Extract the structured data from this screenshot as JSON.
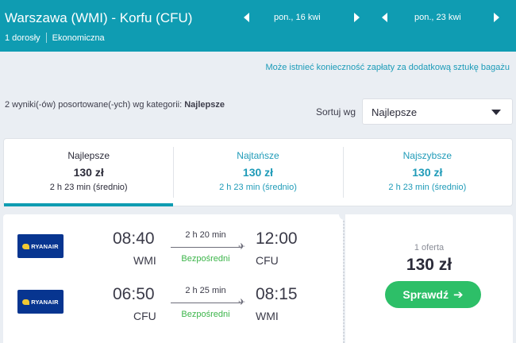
{
  "header": {
    "route": "Warszawa (WMI) - Korfu (CFU)",
    "passengers": "1 dorosły",
    "cabin": "Ekonomiczna",
    "departure_date": "pon., 16 kwi",
    "return_date": "pon., 23 kwi"
  },
  "bag_notice": "Może istnieć konieczność zapłaty za dodatkową sztukę bagażu",
  "results": {
    "count_text": "2 wyniki(-ów) posortowane(-ych) wg kategorii:",
    "sort_category": "Najlepsze",
    "sort_label": "Sortuj wg",
    "sort_selected": "Najlepsze"
  },
  "tabs": [
    {
      "title": "Najlepsze",
      "price": "130 zł",
      "duration": "2 h 23 min (średnio)"
    },
    {
      "title": "Najtańsze",
      "price": "130 zł",
      "duration": "2 h 23 min (średnio)"
    },
    {
      "title": "Najszybsze",
      "price": "130 zł",
      "duration": "2 h 23 min (średnio)"
    }
  ],
  "flight": {
    "airline_logo": "RYANAIR",
    "legs": [
      {
        "depart_time": "08:40",
        "depart_code": "WMI",
        "duration": "2 h 20 min",
        "stops": "Bezpośredni",
        "arrive_time": "12:00",
        "arrive_code": "CFU"
      },
      {
        "depart_time": "06:50",
        "depart_code": "CFU",
        "duration": "2 h 25 min",
        "stops": "Bezpośredni",
        "arrive_time": "08:15",
        "arrive_code": "WMI"
      }
    ],
    "offer_count": "1 oferta",
    "price": "130 zł",
    "cta": "Sprawdź"
  },
  "colors": {
    "header_bg": "#0f9cb2",
    "accent": "#1f9bb8",
    "cta_green": "#2dbf68",
    "direct_green": "#3cb54a",
    "airline_blue": "#073590"
  },
  "icons": {
    "nav_prev": "triangle-left",
    "nav_next": "triangle-right",
    "dropdown": "caret-down",
    "plane": "airplane",
    "cta_arrow": "arrow-right"
  }
}
